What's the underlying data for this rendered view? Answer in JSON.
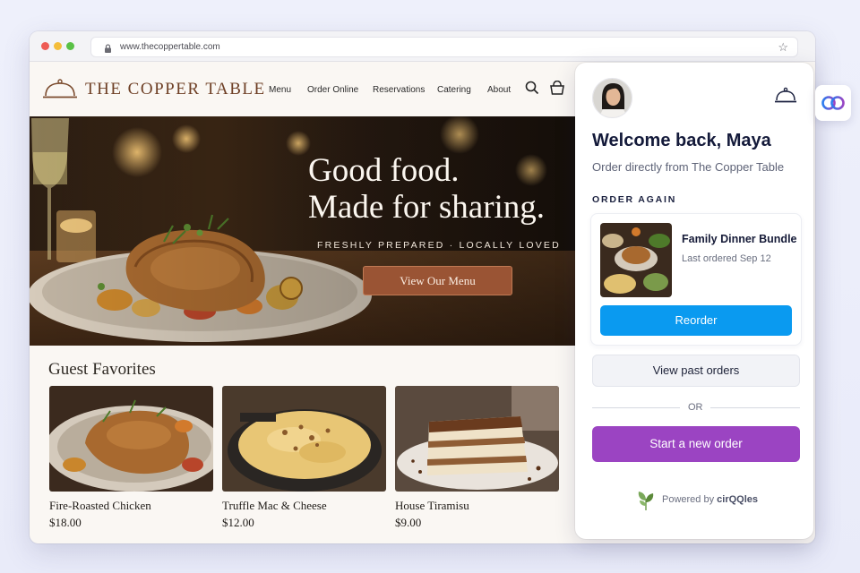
{
  "browser": {
    "url": "www.thecoppertable.com"
  },
  "site": {
    "brand": "The Copper Table",
    "nav": [
      "Menu",
      "Order Online",
      "Reservations",
      "Catering",
      "About"
    ],
    "hero": {
      "title_line1": "Good food.",
      "title_line2": "Made for sharing.",
      "subtitle": "FRESHLY PREPARED · LOCALLY LOVED",
      "button": "View Our Menu"
    },
    "favorites": {
      "title": "Guest Favorites",
      "items": [
        {
          "name": "Fire-Roasted Chicken",
          "price": "$18.00"
        },
        {
          "name": "Truffle Mac & Cheese",
          "price": "$12.00"
        },
        {
          "name": "House Tiramisu",
          "price": "$9.00"
        }
      ]
    }
  },
  "panel": {
    "welcome": "Welcome back, Maya",
    "subtitle": "Order directly from The Copper Table",
    "section_label": "ORDER AGAIN",
    "bundle": {
      "name": "Family Dinner Bundle",
      "last_ordered": "Last ordered Sep 12"
    },
    "reorder_button": "Reorder",
    "past_orders_button": "View past orders",
    "divider": "OR",
    "new_order_button": "Start a new order",
    "powered_prefix": "Powered by",
    "powered_brand": "cirQQles"
  },
  "colors": {
    "brand_copper": "#6e3f25",
    "hero_button": "#9a5434",
    "reorder_blue": "#0a9af0",
    "new_order_purple": "#9b44c2",
    "heading_navy": "#141a3a"
  },
  "icons": {
    "logo": "cloche-icon",
    "search": "search-icon",
    "cart": "shopping-bag-icon",
    "bell": "cloche-icon",
    "lock": "lock-icon",
    "star": "star-icon",
    "powered": "leaf-icon",
    "widget": "cirqqles-logo-icon"
  }
}
